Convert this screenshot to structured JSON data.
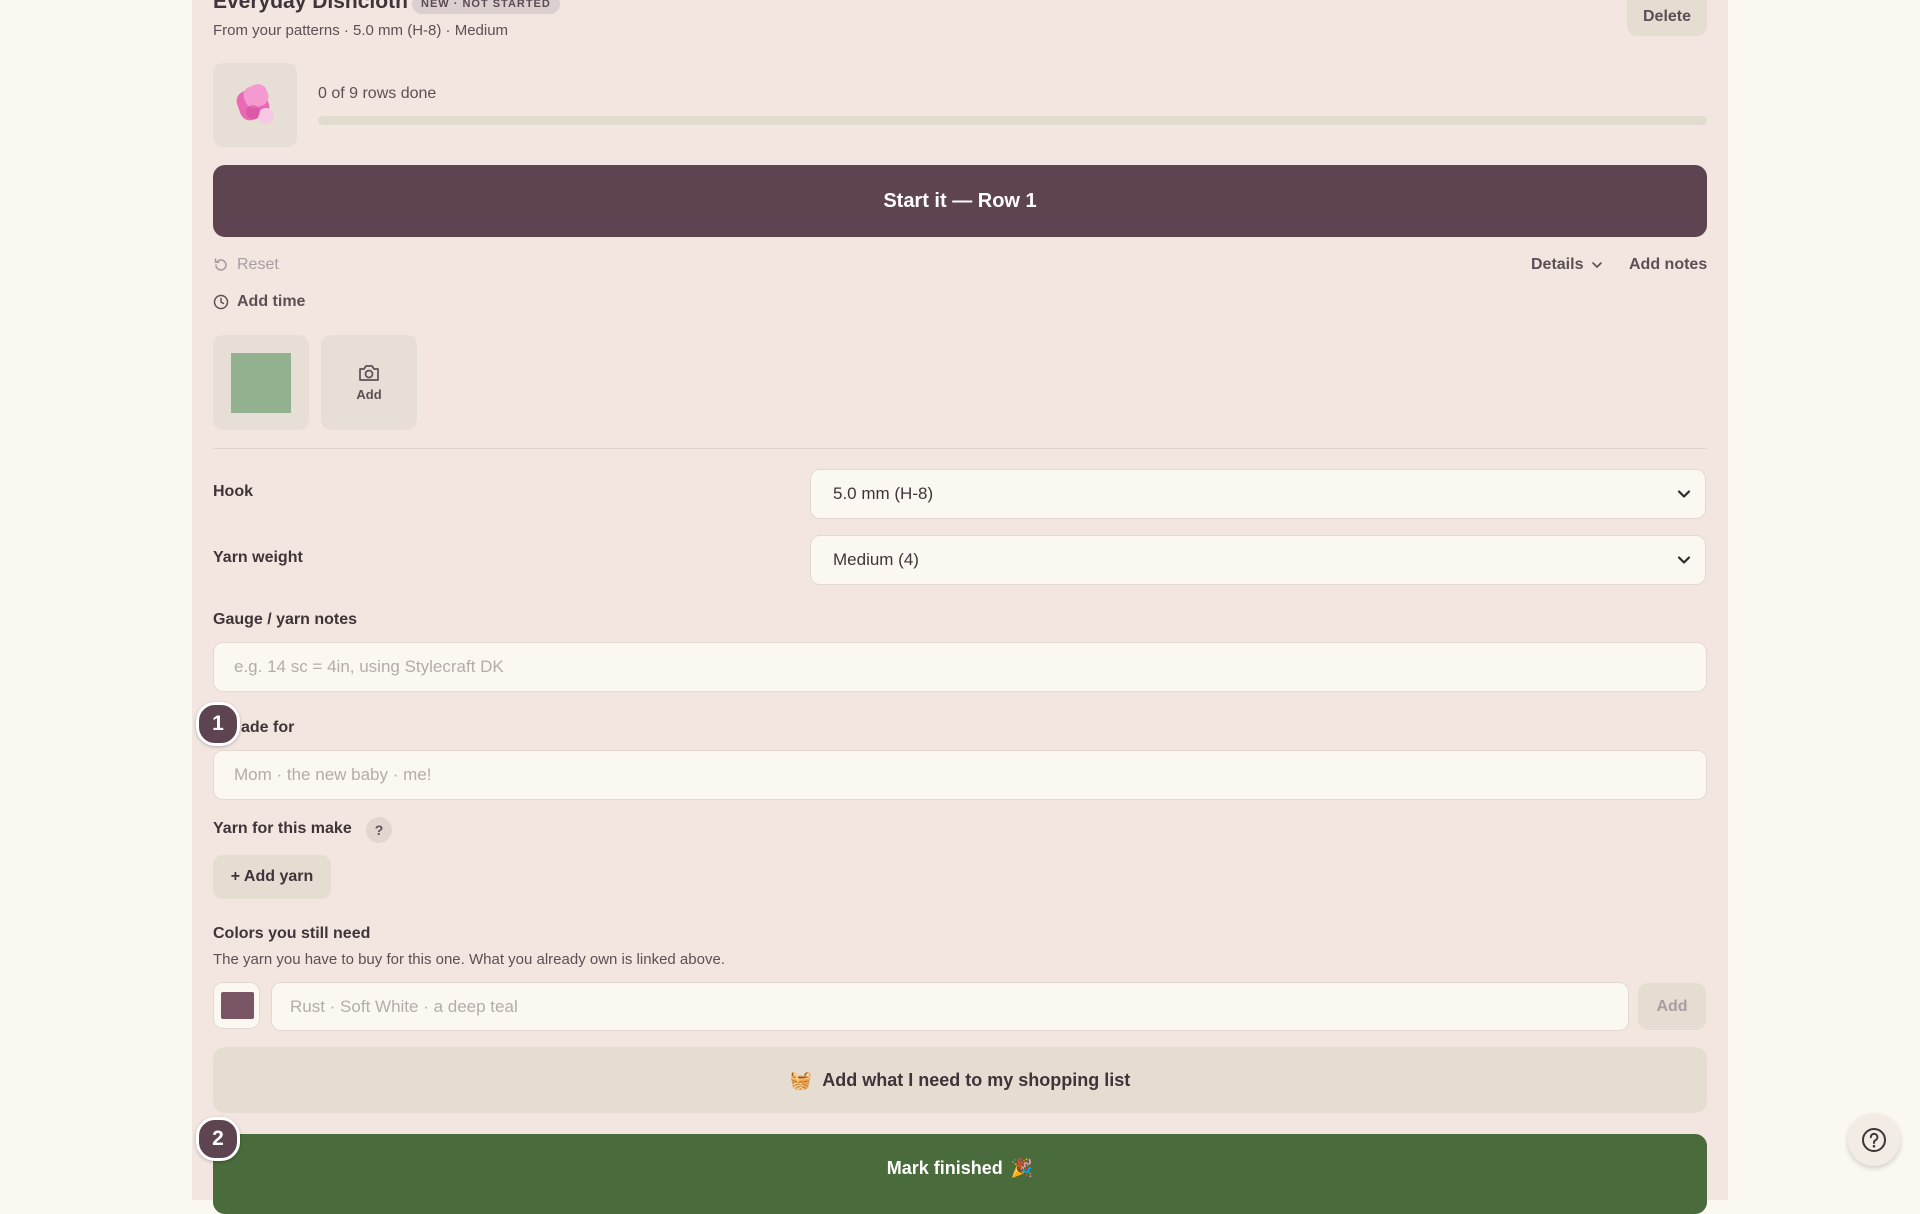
{
  "project": {
    "title": "Everyday Dishcloth",
    "badge": "NEW · NOT STARTED",
    "subtitle": "From your patterns · 5.0 mm (H-8) · Medium",
    "delete_label": "Delete",
    "thumb_icon": "pink-yarn-ball-icon"
  },
  "progress": {
    "rows_text": "0 of 9 rows done",
    "rows_done": 0,
    "rows_total": 9
  },
  "actions": {
    "start_label": "Start it — Row 1",
    "reset_label": "Reset",
    "details_label": "Details",
    "add_notes_label": "Add notes",
    "add_time_label": "Add time"
  },
  "photos": {
    "add_label": "Add"
  },
  "form": {
    "hook_label": "Hook",
    "hook_value": "5.0 mm (H-8)",
    "yarn_weight_label": "Yarn weight",
    "yarn_weight_value": "Medium (4)",
    "gauge_label": "Gauge / yarn notes",
    "gauge_placeholder": "e.g. 14 sc = 4in, using Stylecraft DK",
    "made_for_label": "ade for",
    "made_for_placeholder": "Mom · the new baby · me!",
    "yarn_label": "Yarn for this make",
    "yarn_help": "?",
    "add_yarn_label": "+ Add yarn",
    "colors_label": "Colors you still need",
    "colors_helper": "The yarn you have to buy for this one. What you already own is linked above.",
    "colors_placeholder": "Rust · Soft White · a deep teal",
    "colors_add_label": "Add",
    "swatch_color": "#7a5566"
  },
  "shopping": {
    "label": "Add what I need to my shopping list",
    "emoji": "🧺"
  },
  "finish": {
    "label": "Mark finished",
    "emoji": "🎉"
  },
  "steps": {
    "one": "1",
    "two": "2"
  },
  "colors": {
    "accent": "#5e4450",
    "finish": "#4a6b3b",
    "panel": "#f3e6e0"
  }
}
